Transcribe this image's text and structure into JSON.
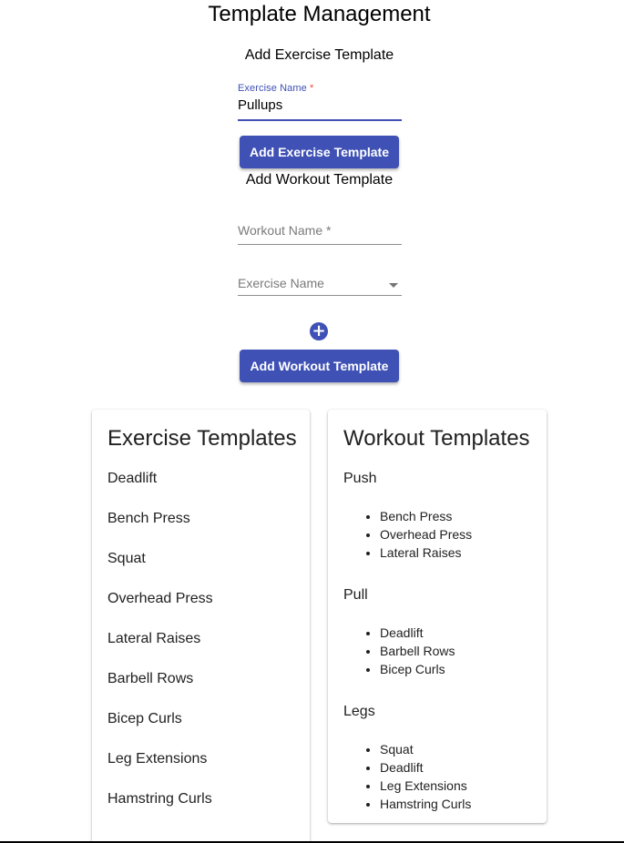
{
  "page": {
    "title": "Template Management"
  },
  "add_exercise": {
    "section_title": "Add Exercise Template",
    "field_label": "Exercise Name",
    "required_mark": "*",
    "field_value": "Pullups",
    "button_label": "Add Exercise Template"
  },
  "add_workout": {
    "section_title": "Add Workout Template",
    "workout_name_placeholder": "Workout Name *",
    "exercise_select_placeholder": "Exercise Name",
    "add_icon": "plus-circle-icon",
    "add_icon_glyph": "+",
    "button_label": "Add Workout Template"
  },
  "exercise_templates": {
    "title": "Exercise Templates",
    "items": [
      "Deadlift",
      "Bench Press",
      "Squat",
      "Overhead Press",
      "Lateral Raises",
      "Barbell Rows",
      "Bicep Curls",
      "Leg Extensions",
      "Hamstring Curls"
    ]
  },
  "workout_templates": {
    "title": "Workout Templates",
    "workouts": [
      {
        "name": "Push",
        "exercises": [
          "Bench Press",
          "Overhead Press",
          "Lateral Raises"
        ]
      },
      {
        "name": "Pull",
        "exercises": [
          "Deadlift",
          "Barbell Rows",
          "Bicep Curls"
        ]
      },
      {
        "name": "Legs",
        "exercises": [
          "Squat",
          "Deadlift",
          "Leg Extensions",
          "Hamstring Curls"
        ]
      }
    ]
  },
  "colors": {
    "primary": "#3f51b5",
    "required": "#f44336"
  }
}
